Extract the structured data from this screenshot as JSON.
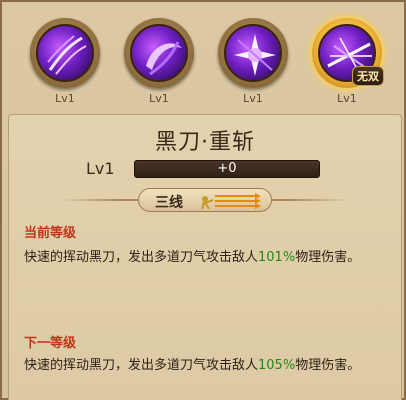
{
  "skills": [
    {
      "level": "Lv1",
      "icon": "claw-slash-icon"
    },
    {
      "level": "Lv1",
      "icon": "crescent-slash-icon"
    },
    {
      "level": "Lv1",
      "icon": "star-burst-icon"
    },
    {
      "level": "Lv1",
      "icon": "blade-burst-icon",
      "tag": "无双"
    }
  ],
  "detail": {
    "title": "黑刀·重斩",
    "level_label": "Lv1",
    "progress_text": "+0",
    "progress_fraction": 0,
    "range_label": "三线"
  },
  "current": {
    "heading": "当前等级",
    "desc_before": "快速的挥动黑刀，发出多道刀气攻击敌人",
    "percent": "101%",
    "desc_after": "物理伤害。"
  },
  "next": {
    "heading": "下一等级",
    "desc_before": "快速的挥动黑刀，发出多道刀气攻击敌人",
    "percent": "105%",
    "desc_after": "物理伤害。"
  },
  "colors": {
    "heading": "#c0361b",
    "percent": "#1f8a14",
    "bar": "#9a3b1b"
  }
}
